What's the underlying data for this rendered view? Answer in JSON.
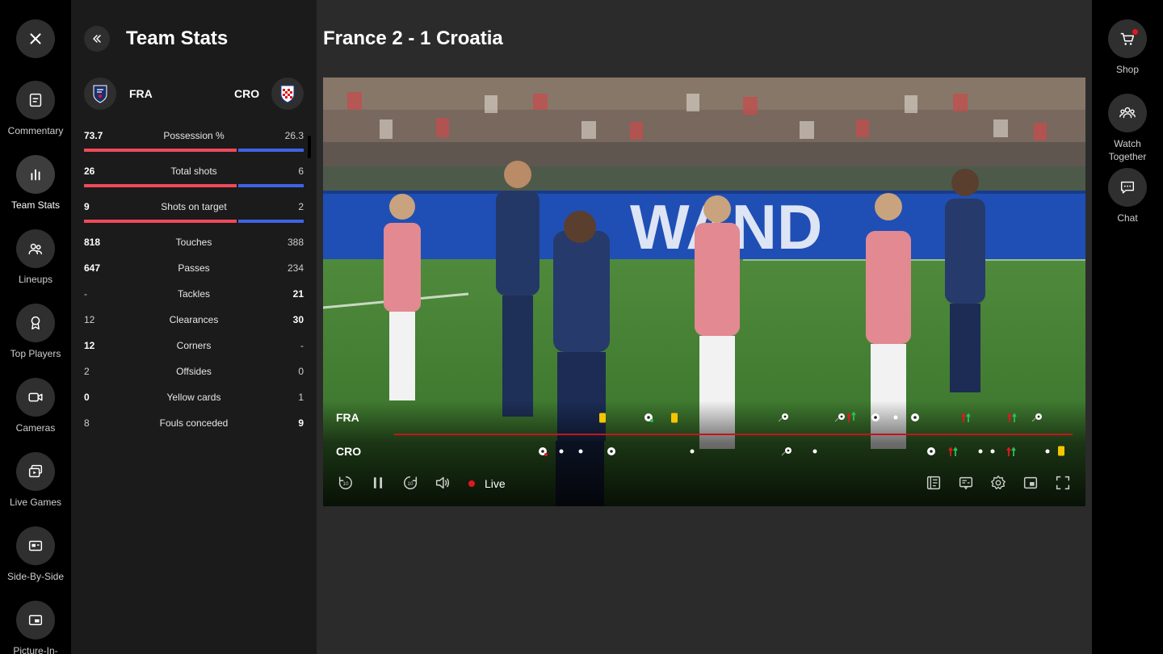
{
  "left_nav": {
    "close_label": "",
    "items": [
      {
        "id": "commentary",
        "label": "Commentary",
        "icon": "document-icon",
        "active": false
      },
      {
        "id": "team-stats",
        "label": "Team Stats",
        "icon": "bar-chart-icon",
        "active": true
      },
      {
        "id": "lineups",
        "label": "Lineups",
        "icon": "people-icon",
        "active": false
      },
      {
        "id": "top-players",
        "label": "Top Players",
        "icon": "award-icon",
        "active": false
      },
      {
        "id": "cameras",
        "label": "Cameras",
        "icon": "video-camera-icon",
        "active": false
      },
      {
        "id": "live-games",
        "label": "Live Games",
        "icon": "stacked-screens-icon",
        "active": false
      },
      {
        "id": "side-by-side",
        "label": "Side-By-Side",
        "icon": "side-by-side-icon",
        "active": false
      },
      {
        "id": "picture-in-picture",
        "label": "Picture-In-",
        "icon": "picture-in-picture-icon",
        "active": false
      }
    ]
  },
  "stats_panel": {
    "title": "Team Stats",
    "home": {
      "abbr": "FRA",
      "logo_icon": "fff-crest-icon"
    },
    "away": {
      "abbr": "CRO",
      "logo_icon": "hns-crest-icon"
    },
    "rows": [
      {
        "label": "Possession %",
        "home": "73.7",
        "away": "26.3",
        "home_bold": true,
        "away_bold": false,
        "bar": true,
        "home_share": 0.7
      },
      {
        "label": "Total shots",
        "home": "26",
        "away": "6",
        "home_bold": true,
        "away_bold": false,
        "bar": true,
        "home_share": 0.7
      },
      {
        "label": "Shots on target",
        "home": "9",
        "away": "2",
        "home_bold": true,
        "away_bold": false,
        "bar": true,
        "home_share": 0.7
      },
      {
        "label": "Touches",
        "home": "818",
        "away": "388",
        "home_bold": true,
        "away_bold": false,
        "bar": false
      },
      {
        "label": "Passes",
        "home": "647",
        "away": "234",
        "home_bold": true,
        "away_bold": false,
        "bar": false
      },
      {
        "label": "Tackles",
        "home": "-",
        "away": "21",
        "home_bold": false,
        "away_bold": true,
        "bar": false
      },
      {
        "label": "Clearances",
        "home": "12",
        "away": "30",
        "home_bold": false,
        "away_bold": true,
        "bar": false
      },
      {
        "label": "Corners",
        "home": "12",
        "away": "-",
        "home_bold": true,
        "away_bold": false,
        "bar": false
      },
      {
        "label": "Offsides",
        "home": "2",
        "away": "0",
        "home_bold": false,
        "away_bold": false,
        "bar": false
      },
      {
        "label": "Yellow cards",
        "home": "0",
        "away": "1",
        "home_bold": true,
        "away_bold": false,
        "bar": false
      },
      {
        "label": "Fouls conceded",
        "home": "8",
        "away": "9",
        "home_bold": false,
        "away_bold": true,
        "bar": false
      }
    ]
  },
  "match": {
    "title": "France 2 - 1 Croatia",
    "player": {
      "live_label": "Live",
      "timeline": {
        "home_label": "FRA",
        "away_label": "CRO"
      }
    }
  },
  "right_nav": {
    "items": [
      {
        "id": "shop",
        "label": "Shop",
        "icon": "cart-icon",
        "badge": true
      },
      {
        "id": "watch-together",
        "label": "Watch Together",
        "icon": "group-icon",
        "badge": false
      },
      {
        "id": "chat",
        "label": "Chat",
        "icon": "chat-icon",
        "badge": false
      }
    ]
  },
  "colors": {
    "home_bar": "#ef4a5a",
    "away_bar": "#3f63e6",
    "timeline": "#c4161c",
    "live": "#e2171e"
  }
}
